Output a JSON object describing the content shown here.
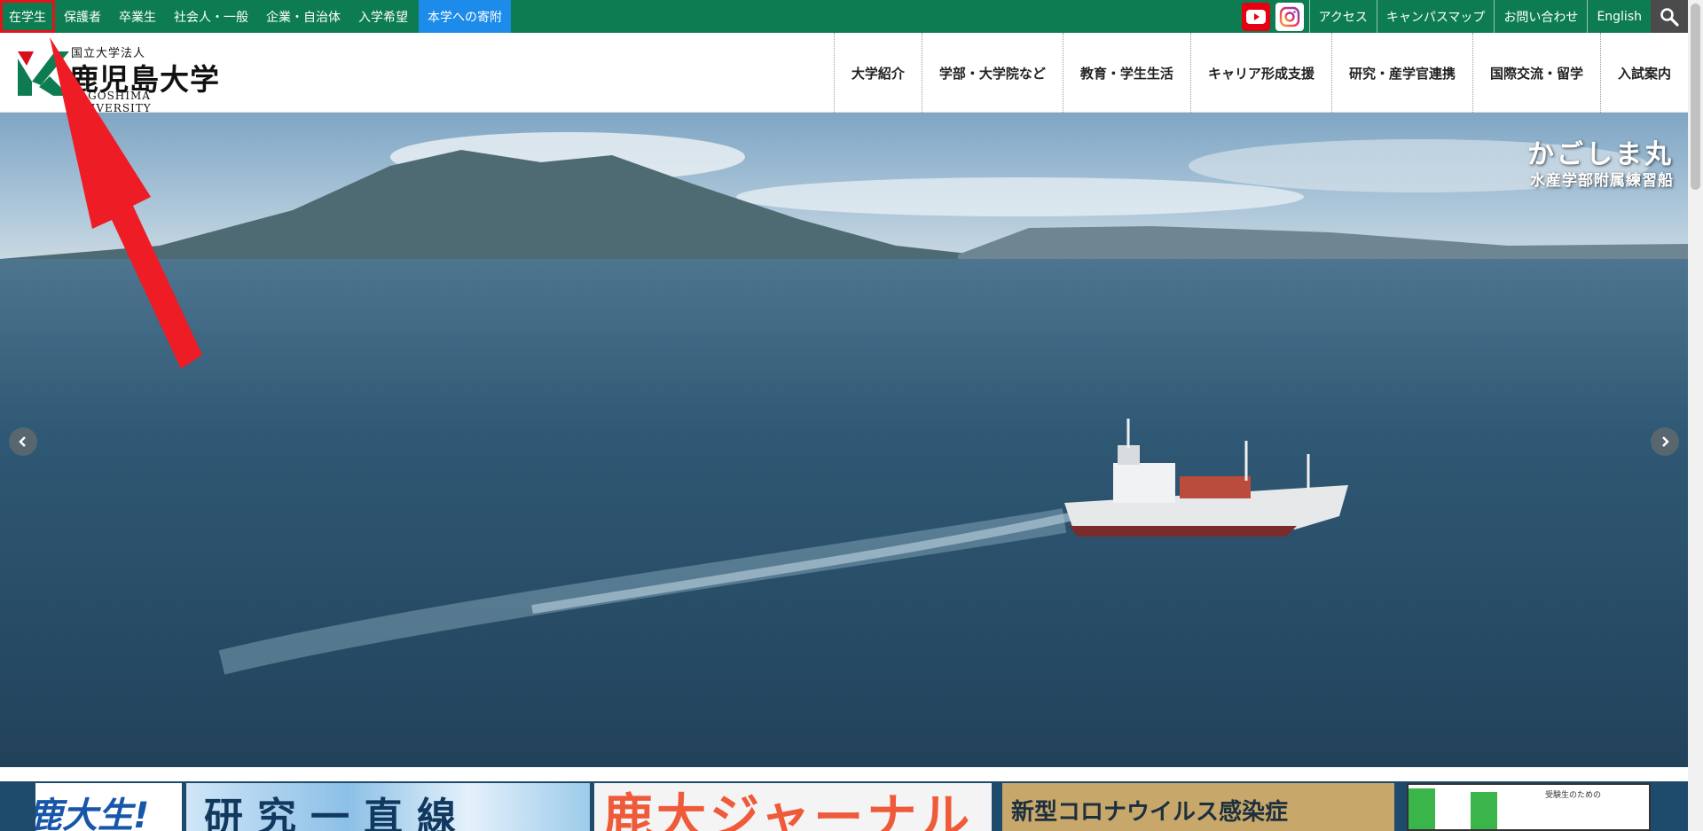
{
  "audience_nav": {
    "items": [
      "在学生",
      "保護者",
      "卒業生",
      "社会人・一般",
      "企業・自治体",
      "入学希望"
    ],
    "donate": "本学への寄附"
  },
  "utility_nav": {
    "youtube": "youtube-icon",
    "instagram": "instagram-icon",
    "links": [
      "アクセス",
      "キャンパスマップ",
      "お問い合わせ",
      "English"
    ],
    "search": "search-icon"
  },
  "logo": {
    "sub": "国立大学法人",
    "main": "鹿児島大学",
    "en": "KAGOSHIMA UNIVERSITY"
  },
  "global_nav": [
    "大学紹介",
    "学部・大学院など",
    "教育・学生生活",
    "キャリア形成支援",
    "研究・産学官連携",
    "国際交流・留学",
    "入試案内"
  ],
  "hero": {
    "caption_title": "かごしま丸",
    "caption_sub": "水産学部附属練習船"
  },
  "banners": {
    "b1": "鹿大生!",
    "b2": "研究一直線",
    "b3": "鹿大ジャーナル",
    "b4": "新型コロナウイルス感染症",
    "b5": "受験生のための"
  },
  "colors": {
    "topbar": "#0d7d51",
    "donate": "#1c8bea",
    "highlight": "#e4141b",
    "logo_green": "#0d7d51",
    "logo_red": "#d7101e"
  }
}
